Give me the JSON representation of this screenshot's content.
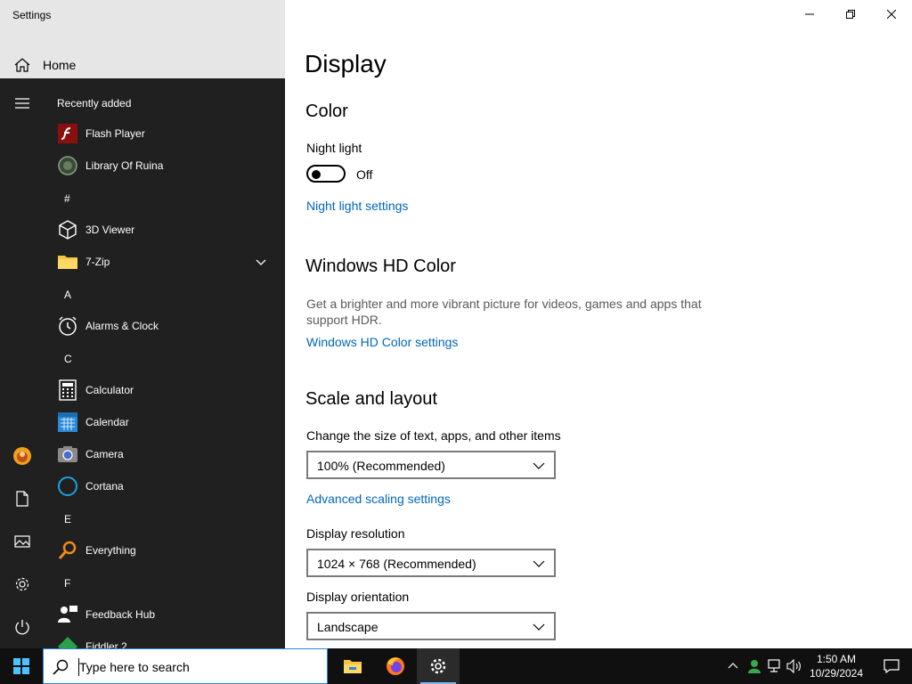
{
  "window": {
    "app_title": "Settings",
    "home_label": "Home",
    "controls": [
      "minimize-icon",
      "restore-icon",
      "close-icon"
    ]
  },
  "start_menu": {
    "recently_added_label": "Recently added",
    "rail_icons": [
      "hamburger-icon",
      "user-avatar-icon",
      "documents-icon",
      "pictures-icon",
      "settings-gear-icon",
      "power-icon"
    ],
    "recent": [
      {
        "label": "Flash Player",
        "icon": "flash-player-icon"
      },
      {
        "label": "Library Of Ruina",
        "icon": "library-of-ruina-icon"
      }
    ],
    "groups": [
      {
        "header": "#",
        "items": [
          {
            "label": "3D Viewer",
            "icon": "3d-viewer-icon"
          },
          {
            "label": "7-Zip",
            "icon": "folder-icon",
            "expandable": true
          }
        ]
      },
      {
        "header": "A",
        "items": [
          {
            "label": "Alarms & Clock",
            "icon": "alarm-clock-icon"
          }
        ]
      },
      {
        "header": "C",
        "items": [
          {
            "label": "Calculator",
            "icon": "calculator-icon"
          },
          {
            "label": "Calendar",
            "icon": "calendar-icon"
          },
          {
            "label": "Camera",
            "icon": "camera-icon"
          },
          {
            "label": "Cortana",
            "icon": "cortana-icon"
          }
        ]
      },
      {
        "header": "E",
        "items": [
          {
            "label": "Everything",
            "icon": "everything-search-icon"
          }
        ]
      },
      {
        "header": "F",
        "items": [
          {
            "label": "Feedback Hub",
            "icon": "feedback-hub-icon"
          },
          {
            "label": "Fiddler 2",
            "icon": "fiddler-icon"
          }
        ]
      }
    ]
  },
  "display": {
    "page_title": "Display",
    "color": {
      "section_title": "Color",
      "night_light_label": "Night light",
      "night_light_state": "Off",
      "night_light_on": false,
      "night_light_link": "Night light settings"
    },
    "hdr": {
      "section_title": "Windows HD Color",
      "description": "Get a brighter and more vibrant picture for videos, games and apps that support HDR.",
      "link": "Windows HD Color settings"
    },
    "scale": {
      "section_title": "Scale and layout",
      "size_label": "Change the size of text, apps, and other items",
      "size_value": "100% (Recommended)",
      "advanced_link": "Advanced scaling settings",
      "resolution_label": "Display resolution",
      "resolution_value": "1024 × 768 (Recommended)",
      "orientation_label": "Display orientation",
      "orientation_value": "Landscape"
    }
  },
  "taskbar": {
    "search_placeholder": "Type here to search",
    "pinned": [
      "file-explorer-icon",
      "firefox-icon",
      "settings-gear-icon"
    ],
    "active_app": "settings-gear-icon",
    "tray": [
      "chevron-up-icon",
      "network-user-icon",
      "network-icon",
      "volume-icon"
    ],
    "time": "1:50 AM",
    "date": "10/29/2024",
    "notification_icon": "action-center-icon"
  },
  "colors": {
    "accent_link": "#0067b8",
    "start_bg": "#202020",
    "taskbar_bg": "#101010",
    "left_pane_bg": "#e6e6e6"
  }
}
